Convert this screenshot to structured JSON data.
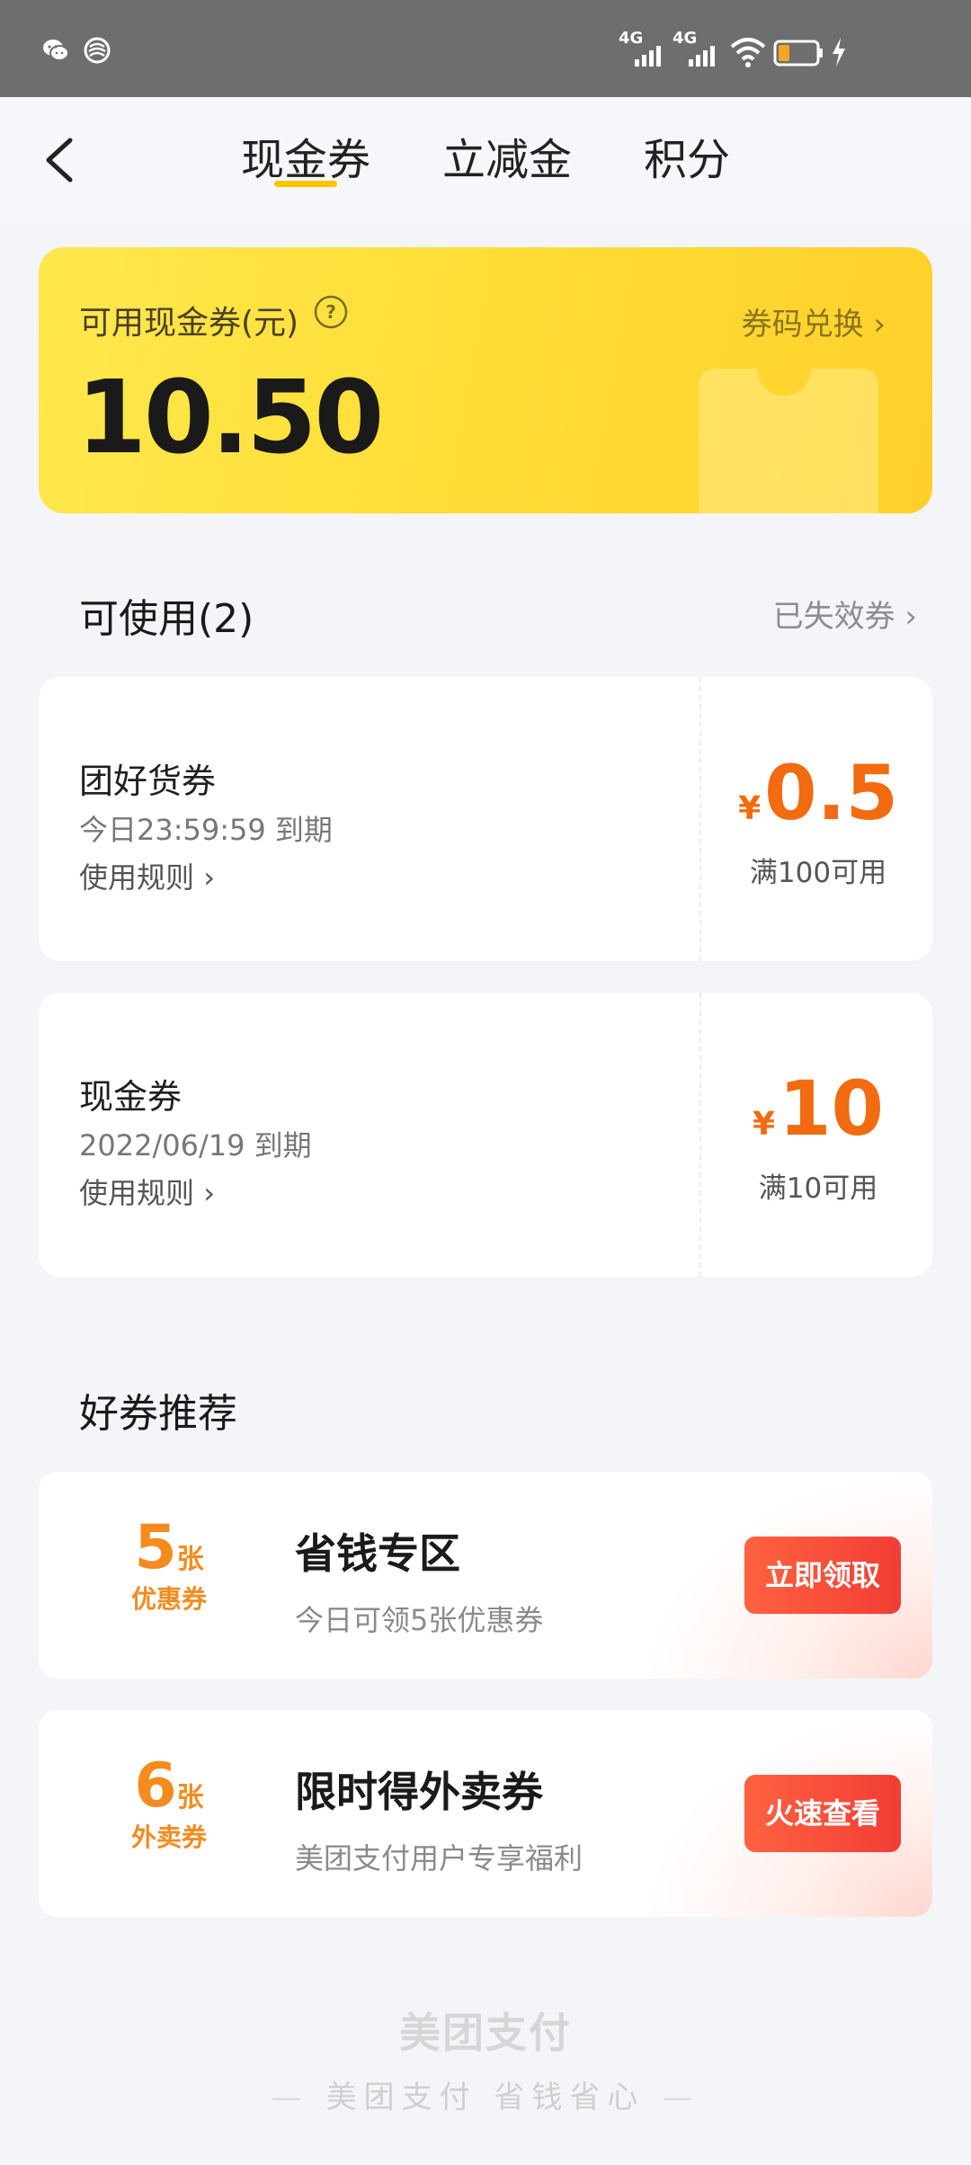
{
  "nav": {
    "tabs": [
      {
        "label": "现金券",
        "active": true
      },
      {
        "label": "立减金",
        "active": false
      },
      {
        "label": "积分",
        "active": false
      }
    ],
    "accent_color": "#ffc300"
  },
  "hero": {
    "label": "可用现金券(元)",
    "amount": "10.50",
    "link": "券码兑换"
  },
  "available": {
    "title": "可使用(2)",
    "expired_link": "已失效券"
  },
  "coupons": [
    {
      "name": "团好货券",
      "expiry": "今日23:59:59 到期",
      "rule": "使用规则",
      "currency": "¥",
      "amount": "0.5",
      "condition": "满100可用"
    },
    {
      "name": "现金券",
      "expiry": "2022/06/19 到期",
      "rule": "使用规则",
      "currency": "¥",
      "amount": "10",
      "condition": "满10可用"
    }
  ],
  "recommend": {
    "title": "好券推荐",
    "items": [
      {
        "count": "5",
        "unit": "张",
        "type": "优惠券",
        "title": "省钱专区",
        "subtitle": "今日可领5张优惠券",
        "button": "立即领取"
      },
      {
        "count": "6",
        "unit": "张",
        "type": "外卖券",
        "title": "限时得外卖券",
        "subtitle": "美团支付用户专享福利",
        "button": "火速查看"
      }
    ]
  },
  "footer": {
    "brand": "美团支付",
    "slogan": "美团支付 省钱省心"
  },
  "colors": {
    "orange": "#f26b10",
    "button_red": "#f23d35"
  }
}
